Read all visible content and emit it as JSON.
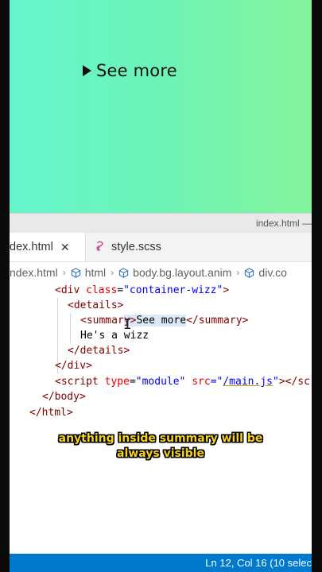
{
  "preview": {
    "summary_text": "See more",
    "background_gradient": [
      "#64f5cf",
      "#86f49a"
    ]
  },
  "window": {
    "title": "index.html —"
  },
  "tabs": [
    {
      "label": "dex.html",
      "active": true,
      "icon": "close-icon"
    },
    {
      "label": "style.scss",
      "active": false,
      "icon": "scss-icon"
    }
  ],
  "breadcrumb": [
    {
      "label": "ndex.html",
      "icon": null
    },
    {
      "label": "html",
      "icon": "cube-icon"
    },
    {
      "label": "body.bg.layout.anim",
      "icon": "cube-icon"
    },
    {
      "label": "div.co",
      "icon": "cube-icon"
    }
  ],
  "code": {
    "line1": {
      "open": "<div ",
      "attr": "class",
      "eq": "=",
      "val": "\"container-wizz\"",
      "close": ">"
    },
    "line2": "<details>",
    "line3": {
      "open": "<summar",
      "selected_text": "y>See more",
      "close": "</summary>"
    },
    "line4": "He's a wizz",
    "line5": "</details>",
    "line6": "</div>",
    "line7": {
      "open": "<script ",
      "attr1": "type",
      "val1": "\"module\"",
      "attr2": "src",
      "val2_q1": "=\"",
      "val2": "/main.js",
      "val2_q2": "\"",
      "close": "></sc"
    },
    "line8": "</body>",
    "line9": "</html>"
  },
  "caption": {
    "line1": "anything inside summary will be",
    "line2": "always visible"
  },
  "statusbar": {
    "text": "Ln 12, Col 16 (10 selec",
    "color": "#007acc"
  }
}
